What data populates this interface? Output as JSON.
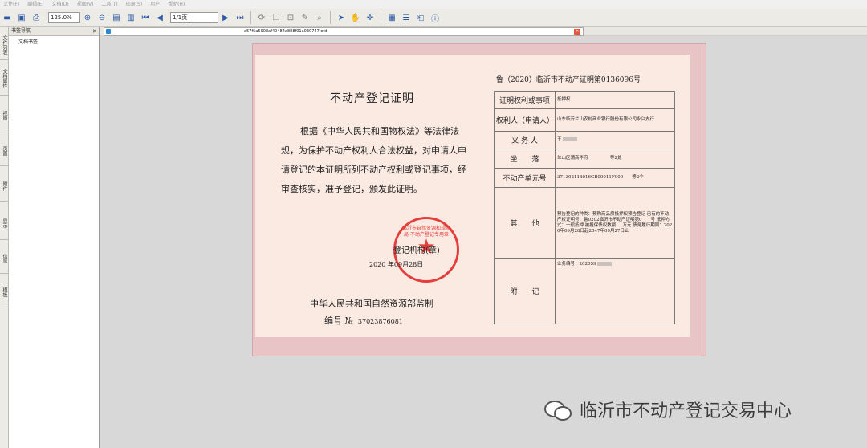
{
  "menu": [
    "文件(F)",
    "编辑(E)",
    "文档(D)",
    "视图(V)",
    "工具(T)",
    "印章(S)",
    "用户",
    "帮助(H)"
  ],
  "toolbar": {
    "zoom": "125.0%",
    "page": "1/1页"
  },
  "vtabs": [
    "文件列表",
    "文档属性",
    "视图",
    "页面",
    "附件",
    "显示",
    "信息",
    "模板"
  ],
  "panel": {
    "title": "书签导航",
    "item": "文档书签"
  },
  "doc_tab": {
    "filename": "a57f6a5908af40484a888f01a030747.ofd"
  },
  "cert": {
    "title": "不动产登记证明",
    "body": "根据《中华人民共和国物权法》等法律法规，为保护不动产权利人合法权益，对申请人申请登记的本证明所列不动产权利或登记事项，经审查核实，准予登记，颁发此证明。",
    "seal_label": "登记机构(章)",
    "seal_text": "临沂市自然资源和规划局 不动产登记专用章",
    "seal_date": "2020  年09月28日",
    "ministry": "中华人民共和国自然资源部监制",
    "serial_label": "编号 №",
    "serial": "37023876081",
    "cert_no": "鲁（2020）临沂市不动产证明第0136096号",
    "rows": [
      {
        "key": "证明权利或事项",
        "value": "抵押权"
      },
      {
        "key": "权利人（申请人）",
        "value": "山东临沂兰山农村商业银行股份有限公司永兴支行"
      },
      {
        "key": "义 务 人",
        "value": "王"
      },
      {
        "key": "坐　　落",
        "value": "兰山区蒲商华府　　　　　等2处"
      },
      {
        "key": "不动产单元号",
        "value": "371302114016GB00011F000　　等2个"
      },
      {
        "key": "其　　他",
        "value": "预告登记的种类：预购商品房抵押权预告登记 已有的不动产权证明号：鲁0202临沂市不动产证明第0　　号 抵押方式：一般抵押 被担保债权数额：　万元 债务履行期限：2020年09月28日起2047年09月27日止"
      },
      {
        "key": "附　　记",
        "value": "业务编号：202059"
      }
    ]
  },
  "watermark": "临沂市不动产登记交易中心"
}
